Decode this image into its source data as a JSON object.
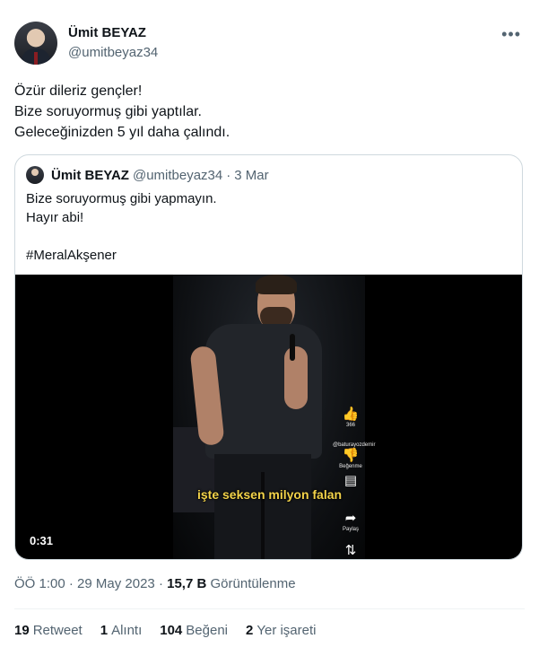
{
  "author": {
    "name": "Ümit BEYAZ",
    "handle": "@umitbeyaz34",
    "more_icon": "more-options-icon"
  },
  "tweet": {
    "lines": [
      "Özür dileriz gençler!",
      "Bize soruyormuş gibi yaptılar.",
      "Geleceğinizden 5 yıl daha çalındı."
    ]
  },
  "quote": {
    "name": "Ümit BEYAZ",
    "handle": "@umitbeyaz34",
    "dot": "·",
    "date": "3 Mar",
    "lines": [
      "Bize soruyormuş gibi yapmayın.",
      "Hayır abi!",
      "",
      "#MeralAkşener"
    ],
    "video": {
      "duration": "0:31",
      "caption": "işte seksen milyon falan",
      "side_labels": {
        "like_count": "366",
        "channel": "@baturayozdemir",
        "dislike": "Beğenme",
        "share": "Paylaş"
      }
    }
  },
  "meta": {
    "time": "ÖÖ 1:00",
    "dot1": "·",
    "date": "29 May 2023",
    "dot2": "·",
    "views_count": "15,7 B",
    "views_label": "Görüntülenme"
  },
  "stats": {
    "retweets_count": "19",
    "retweets_label": "Retweet",
    "quotes_count": "1",
    "quotes_label": "Alıntı",
    "likes_count": "104",
    "likes_label": "Beğeni",
    "bookmarks_count": "2",
    "bookmarks_label": "Yer işareti"
  }
}
